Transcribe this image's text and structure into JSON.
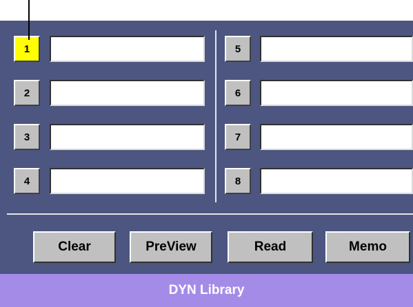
{
  "slots": {
    "left": [
      {
        "number": "1",
        "value": "",
        "selected": true
      },
      {
        "number": "2",
        "value": ""
      },
      {
        "number": "3",
        "value": ""
      },
      {
        "number": "4",
        "value": ""
      }
    ],
    "right": [
      {
        "number": "5",
        "value": ""
      },
      {
        "number": "6",
        "value": ""
      },
      {
        "number": "7",
        "value": ""
      },
      {
        "number": "8",
        "value": ""
      }
    ]
  },
  "actions": {
    "clear_label": "Clear",
    "preview_label": "PreView",
    "read_label": "Read",
    "memo_label": "Memo"
  },
  "footer": {
    "title": "DYN Library"
  },
  "colors": {
    "panel_background": "#4c5680",
    "selected_slot": "#ffff00",
    "button_face": "#c0c0c0",
    "footer_background": "#a48be8",
    "footer_text": "#ffffff"
  }
}
